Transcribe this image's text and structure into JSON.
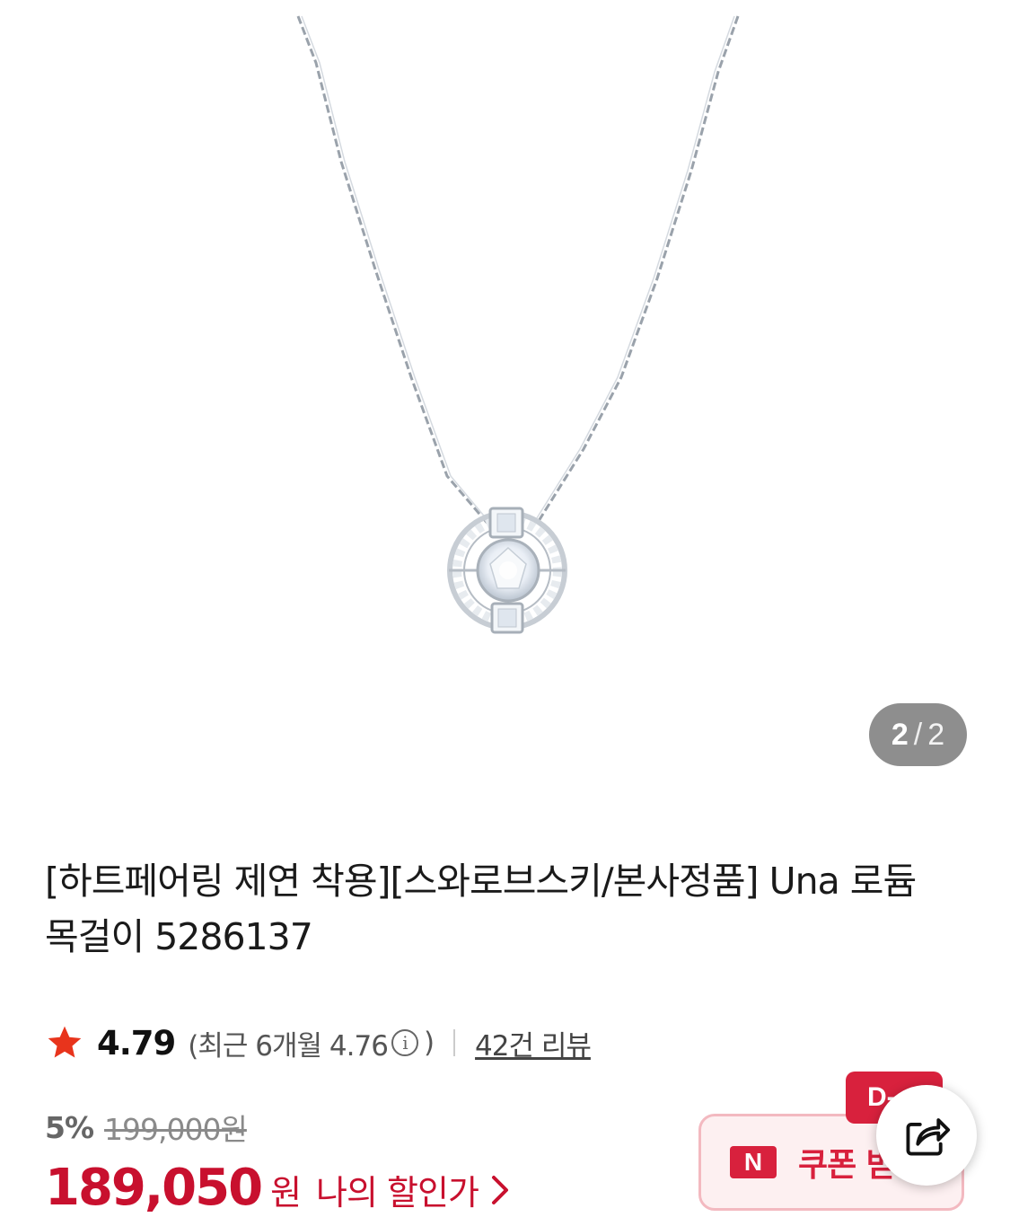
{
  "product": {
    "title_line1": "[하트페어링 제연 착용][스와로브스키/본사정품] Una 로듐",
    "title_line2": "목걸이 5286137"
  },
  "gallery": {
    "current_page": "2",
    "separator": "/",
    "total_pages": "2",
    "image_subject": "necklace"
  },
  "rating": {
    "icon": "star-icon",
    "score": "4.79",
    "recent_prefix": "(최근 6개월 4.76",
    "recent_suffix": ")",
    "info_icon_glyph": "i",
    "review_link": "42건 리뷰"
  },
  "pricing": {
    "discount_rate": "5%",
    "original_price": "199,000원",
    "sale_price": "189,050",
    "currency_unit": "원",
    "my_price_link": "나의 할인가"
  },
  "coupon": {
    "badge_text": "D-",
    "naver_label": "N",
    "label": "쿠폰 받"
  },
  "share": {
    "icon": "share-icon"
  },
  "colors": {
    "accent_red": "#c8102e",
    "badge_red": "#d8213d",
    "coupon_bg": "#fdf0f1",
    "indicator_bg": "#8e8e8e"
  }
}
